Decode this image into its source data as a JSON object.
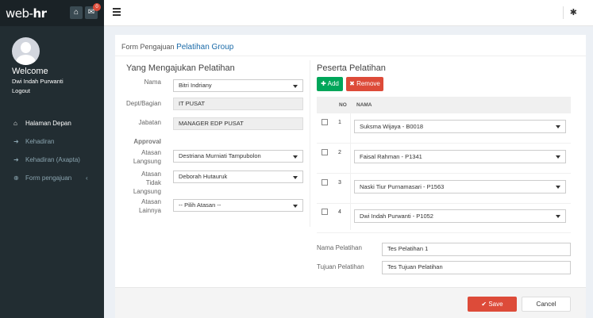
{
  "brand": {
    "prefix": "web-",
    "suffix": "hr",
    "mail_badge": "0"
  },
  "user": {
    "welcome": "Welcome",
    "name": "Dwi Indah Purwanti",
    "logout": "Logout"
  },
  "nav": [
    {
      "label": "Halaman Depan",
      "icon": "home-icon"
    },
    {
      "label": "Kehadiran",
      "icon": "sign-in-icon"
    },
    {
      "label": "Kehadiran (Axapta)",
      "icon": "sign-in-icon"
    },
    {
      "label": "Form pengajuan",
      "icon": "circle-plus-icon"
    }
  ],
  "breadcrumb": {
    "prefix": "Form Pengajuan",
    "current": "Pelatihan Group"
  },
  "left": {
    "title": "Yang Mengajukan Pelatihan",
    "nama_label": "Nama",
    "nama_value": "Bitri Indriany",
    "dept_label": "Dept/Bagian",
    "dept_value": "IT PUSAT",
    "jabatan_label": "Jabatan",
    "jabatan_value": "MANAGER EDP PUSAT",
    "approval_label": "Approval",
    "atasan_langsung_label1": "Atasan",
    "atasan_langsung_label2": "Langsung",
    "atasan_langsung_value": "Destriana Murniati Tampubolon",
    "atasan_tidak_label1": "Atasan",
    "atasan_tidak_label2": "Tidak",
    "atasan_tidak_label3": "Langsung",
    "atasan_tidak_value": "Deborah Hutauruk",
    "atasan_lain_label1": "Atasan",
    "atasan_lain_label2": "Lainnya",
    "atasan_lain_value": "-- Pilih Atasan --"
  },
  "right": {
    "title": "Peserta Pelatihan",
    "add_label": "Add",
    "remove_label": "Remove",
    "col_no": "NO",
    "col_nama": "NAMA",
    "rows": [
      {
        "no": "1",
        "nama": "Suksma Wijaya - B0018"
      },
      {
        "no": "2",
        "nama": "Faisal Rahman - P1341"
      },
      {
        "no": "3",
        "nama": "Naski Tiur Purnamasari - P1563"
      },
      {
        "no": "4",
        "nama": "Dwi Indah Purwanti - P1052"
      }
    ],
    "nama_pelatihan_label": "Nama Pelatihan",
    "nama_pelatihan_value": "Tes Pelatihan 1",
    "tujuan_pelatihan_label": "Tujuan Pelatihan",
    "tujuan_pelatihan_value": "Tes Tujuan Pelatihan"
  },
  "footer": {
    "save_label": "Save",
    "cancel_label": "Cancel"
  },
  "colors": {
    "sidebar": "#222d32",
    "brand_bg": "#1a2226",
    "add": "#00a65a",
    "danger": "#dd4b39",
    "link": "#1a6aa8"
  }
}
